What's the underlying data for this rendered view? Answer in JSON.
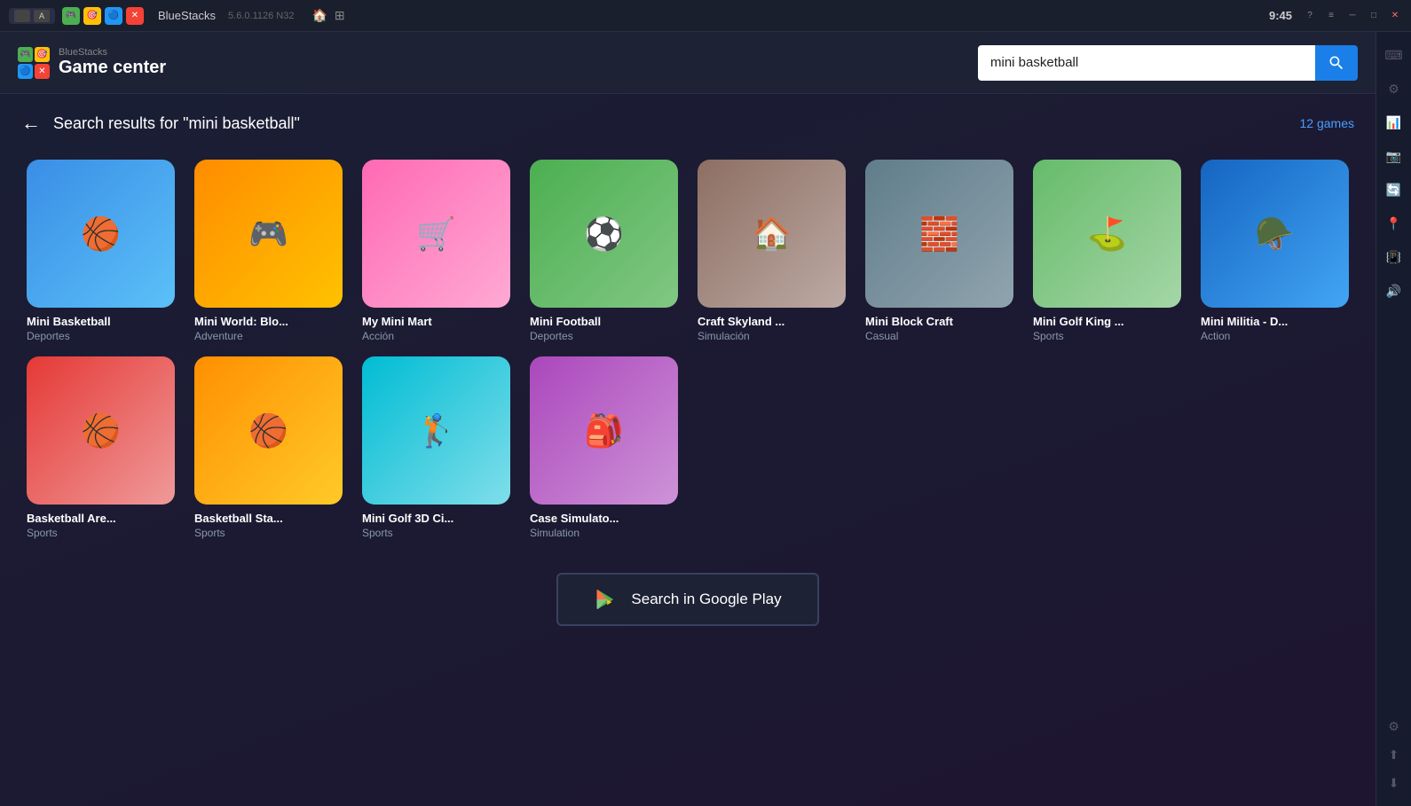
{
  "titleBar": {
    "appName": "BlueStacks",
    "version": "5.6.0.1126 N32",
    "time": "9:45"
  },
  "header": {
    "subtitle": "BlueStacks",
    "title": "Game center",
    "searchPlaceholder": "mini basketball",
    "searchValue": "mini basketball"
  },
  "resultsPage": {
    "backLabel": "←",
    "resultsText": "Search results for ",
    "searchQuery": "\"mini basketball\"",
    "gamesCount": "12 games"
  },
  "games": [
    {
      "id": "mini-basketball",
      "name": "Mini Basketball",
      "category": "Deportes",
      "thumbClass": "thumb-mini-basketball",
      "emoji": "🏀"
    },
    {
      "id": "mini-world",
      "name": "Mini World: Blo...",
      "category": "Adventure",
      "thumbClass": "thumb-mini-world",
      "emoji": "🎮"
    },
    {
      "id": "my-mini-mart",
      "name": "My Mini Mart",
      "category": "Acción",
      "thumbClass": "thumb-mini-mart",
      "emoji": "🛒"
    },
    {
      "id": "mini-football",
      "name": "Mini Football",
      "category": "Deportes",
      "thumbClass": "thumb-mini-football",
      "emoji": "⚽"
    },
    {
      "id": "craft-skyland",
      "name": "Craft Skyland ...",
      "category": "Simulación",
      "thumbClass": "thumb-craft-skyland",
      "emoji": "🏠"
    },
    {
      "id": "mini-block-craft",
      "name": "Mini Block Craft",
      "category": "Casual",
      "thumbClass": "thumb-mini-block",
      "emoji": "🧱"
    },
    {
      "id": "mini-golf-king",
      "name": "Mini Golf King ...",
      "category": "Sports",
      "thumbClass": "thumb-mini-golf",
      "emoji": "⛳"
    },
    {
      "id": "mini-militia",
      "name": "Mini Militia - D...",
      "category": "Action",
      "thumbClass": "thumb-mini-militia",
      "emoji": "🪖"
    },
    {
      "id": "basketball-arena",
      "name": "Basketball Are...",
      "category": "Sports",
      "thumbClass": "thumb-basketball-arena",
      "emoji": "🏀"
    },
    {
      "id": "basketball-stars",
      "name": "Basketball Sta...",
      "category": "Sports",
      "thumbClass": "thumb-basketball-stars",
      "emoji": "🏀"
    },
    {
      "id": "mini-golf-3d",
      "name": "Mini Golf 3D Ci...",
      "category": "Sports",
      "thumbClass": "thumb-mini-golf3d",
      "emoji": "🏌️"
    },
    {
      "id": "case-simulator",
      "name": "Case Simulato...",
      "category": "Simulation",
      "thumbClass": "thumb-case-sim",
      "emoji": "🎒"
    }
  ],
  "googlePlayBtn": {
    "label": "Search in Google Play"
  },
  "sidebarIcons": [
    {
      "name": "help-icon",
      "symbol": "?"
    },
    {
      "name": "menu-icon",
      "symbol": "≡"
    },
    {
      "name": "minimize-icon",
      "symbol": "─"
    },
    {
      "name": "maximize-icon",
      "symbol": "□"
    },
    {
      "name": "close-icon",
      "symbol": "✕"
    },
    {
      "name": "keyboard-icon",
      "symbol": "⌨"
    },
    {
      "name": "settings-icon",
      "symbol": "⚙"
    },
    {
      "name": "performance-icon",
      "symbol": "📊"
    },
    {
      "name": "camera-icon",
      "symbol": "📷"
    },
    {
      "name": "rotate-icon",
      "symbol": "🔄"
    },
    {
      "name": "location-icon",
      "symbol": "📍"
    },
    {
      "name": "shake-icon",
      "symbol": "📳"
    },
    {
      "name": "volume-icon",
      "symbol": "🔊"
    },
    {
      "name": "macro-icon",
      "symbol": "⚡"
    },
    {
      "name": "game-controls-icon",
      "symbol": "🎮"
    }
  ]
}
